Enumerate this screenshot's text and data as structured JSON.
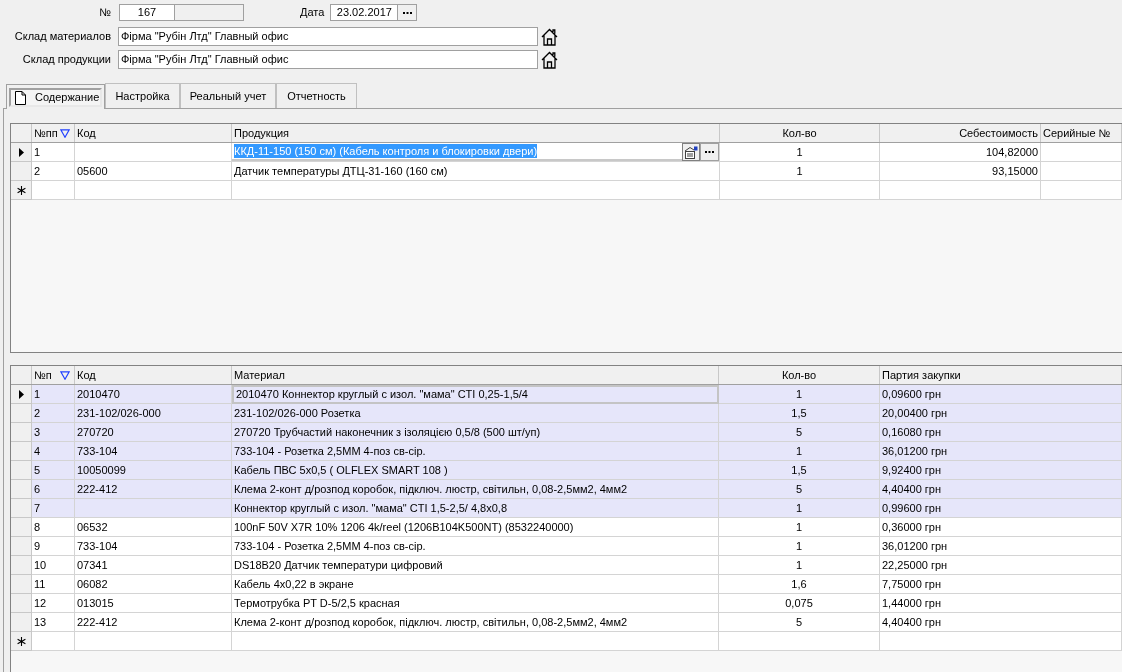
{
  "document": {
    "number": {
      "label": "№",
      "value": "167"
    },
    "date": {
      "label": "Дата",
      "value": "23.02.2017"
    },
    "materials_warehouse": {
      "label": "Склад материалов",
      "value": "Фірма \"Рубін Лтд\" Главный офис"
    },
    "products_warehouse": {
      "label": "Склад продукции",
      "value": "Фірма \"Рубін Лтд\" Главный офис"
    }
  },
  "tabs": [
    {
      "label": "Содержание",
      "selected": true
    },
    {
      "label": "Настройка",
      "selected": false
    },
    {
      "label": "Реальный учет",
      "selected": false
    },
    {
      "label": "Отчетность",
      "selected": false
    }
  ],
  "products_grid": {
    "columns": [
      {
        "label": "№пп",
        "kind": "number",
        "sorted": true
      },
      {
        "label": "Код",
        "kind": "code",
        "sorted": false
      },
      {
        "label": "Продукция",
        "kind": "name",
        "sorted": false
      },
      {
        "label": "Кол-во",
        "kind": "quantity",
        "sorted": false
      },
      {
        "label": "Себестоимость",
        "kind": "cost",
        "sorted": false
      },
      {
        "label": "Серийные №",
        "kind": "text",
        "sorted": false
      }
    ],
    "rows": [
      {
        "selected": true,
        "editing": true,
        "number": "1",
        "product": "ККД-11-150 (150 см) (Кабель контроля и блокировки двери)",
        "quantity": "1",
        "cost": "104,82000"
      },
      {
        "selected": false,
        "editing": false,
        "number": "2",
        "code": "05600",
        "product": "Датчик температуры ДТЦ-31-160 (160 см)",
        "quantity": "1",
        "cost": "93,15000"
      }
    ]
  },
  "materials_grid": {
    "columns": [
      {
        "label": "№п",
        "kind": "number",
        "sorted": true
      },
      {
        "label": "Код",
        "kind": "code",
        "sorted": false
      },
      {
        "label": "Материал",
        "kind": "name",
        "sorted": false
      },
      {
        "label": "Кол-во",
        "kind": "quantity",
        "sorted": false
      },
      {
        "label": "Партия закупки",
        "kind": "price",
        "sorted": false
      }
    ],
    "rows": [
      {
        "selected": true,
        "focused": true,
        "highlighted": true,
        "number": "1",
        "code": "2010470",
        "material": "2010470 Коннектор круглый с изол. \"мама\" CTI 0,25-1,5/4",
        "quantity": "1",
        "batch_price": "0,09600 грн"
      },
      {
        "selected": false,
        "focused": false,
        "highlighted": true,
        "number": "2",
        "code": "231-102/026-000",
        "material": "231-102/026-000 Розетка",
        "quantity": "1,5",
        "batch_price": "20,00400 грн"
      },
      {
        "selected": false,
        "focused": false,
        "highlighted": true,
        "number": "3",
        "code": "270720",
        "material": "270720 Трубчастий наконечник з ізоляцією 0,5/8 (500 шт/уп)",
        "quantity": "5",
        "batch_price": "0,16080 грн"
      },
      {
        "selected": false,
        "focused": false,
        "highlighted": true,
        "number": "4",
        "code": "733-104",
        "material": "733-104 - Розетка 2,5ММ 4-поз св-сір.",
        "quantity": "1",
        "batch_price": "36,01200 грн"
      },
      {
        "selected": false,
        "focused": false,
        "highlighted": true,
        "number": "5",
        "code": "10050099",
        "material": "Кабель ПВС 5х0,5 ( OLFLEX SMART 108 )",
        "quantity": "1,5",
        "batch_price": "9,92400 грн"
      },
      {
        "selected": false,
        "focused": false,
        "highlighted": true,
        "number": "6",
        "code": "222-412",
        "material": "Клема 2-конт д/розпод коробок, підключ. люстр, світильн, 0,08-2,5мм2, 4мм2",
        "quantity": "5",
        "batch_price": "4,40400 грн"
      },
      {
        "selected": false,
        "focused": false,
        "highlighted": true,
        "number": "7",
        "material": "Коннектор круглый с изол. \"мама\" CTI 1,5-2,5/ 4,8х0,8",
        "quantity": "1",
        "batch_price": "0,99600 грн"
      },
      {
        "selected": false,
        "focused": false,
        "highlighted": false,
        "number": "8",
        "code": "06532",
        "material": "100nF 50V X7R 10% 1206 4k/reel (1206B104K500NT) (8532240000)",
        "quantity": "1",
        "batch_price": "0,36000 грн"
      },
      {
        "selected": false,
        "focused": false,
        "highlighted": false,
        "number": "9",
        "code": "733-104",
        "material": "733-104 - Розетка 2,5ММ 4-поз св-сір.",
        "quantity": "1",
        "batch_price": "36,01200 грн"
      },
      {
        "selected": false,
        "focused": false,
        "highlighted": false,
        "number": "10",
        "code": "07341",
        "material": "DS18B20 Датчик температури цифровий",
        "quantity": "1",
        "batch_price": "22,25000 грн"
      },
      {
        "selected": false,
        "focused": false,
        "highlighted": false,
        "number": "11",
        "code": "06082",
        "material": "Кабель 4х0,22 в экране",
        "quantity": "1,6",
        "batch_price": "7,75000 грн"
      },
      {
        "selected": false,
        "focused": false,
        "highlighted": false,
        "number": "12",
        "code": "013015",
        "material": "Термотрубка PT D-5/2,5 красная",
        "quantity": "0,075",
        "batch_price": "1,44000 грн"
      },
      {
        "selected": false,
        "focused": false,
        "highlighted": false,
        "number": "13",
        "code": "222-412",
        "material": "Клема 2-конт д/розпод коробок, підключ. люстр, світильн, 0,08-2,5мм2, 4мм2",
        "quantity": "5",
        "batch_price": "4,40400 грн"
      }
    ]
  }
}
